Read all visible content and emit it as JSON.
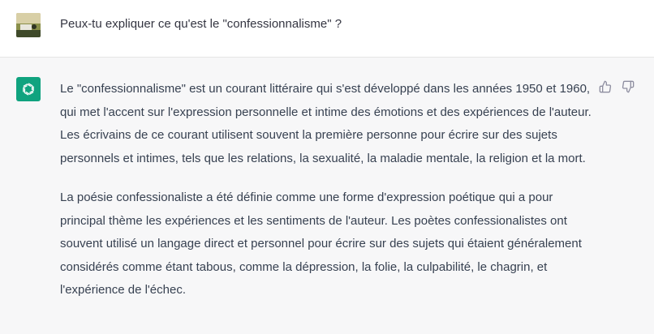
{
  "user_message": {
    "text": "Peux-tu expliquer ce qu'est le \"confessionnalisme\" ?"
  },
  "assistant_message": {
    "paragraphs": [
      "Le \"confessionnalisme\" est un courant littéraire qui s'est développé dans les années 1950 et 1960, qui met l'accent sur l'expression personnelle et intime des émotions et des expériences de l'auteur. Les écrivains de ce courant utilisent souvent la première personne pour écrire sur des sujets personnels et intimes, tels que les relations, la sexualité, la maladie mentale, la religion et la mort.",
      "La poésie confessionaliste a été définie comme une forme d'expression poétique qui a pour principal thème les expériences et les sentiments de l'auteur. Les poètes confessionalistes ont souvent utilisé un langage direct et personnel pour écrire sur des sujets qui étaient généralement considérés comme étant tabous, comme la dépression, la folie, la culpabilité, le chagrin, et l'expérience de l'échec."
    ],
    "feedback_icons": [
      "thumbs-up-icon",
      "thumbs-down-icon"
    ]
  },
  "colors": {
    "assistant_background": "#f7f7f8",
    "bot_avatar": "#10a37f"
  }
}
